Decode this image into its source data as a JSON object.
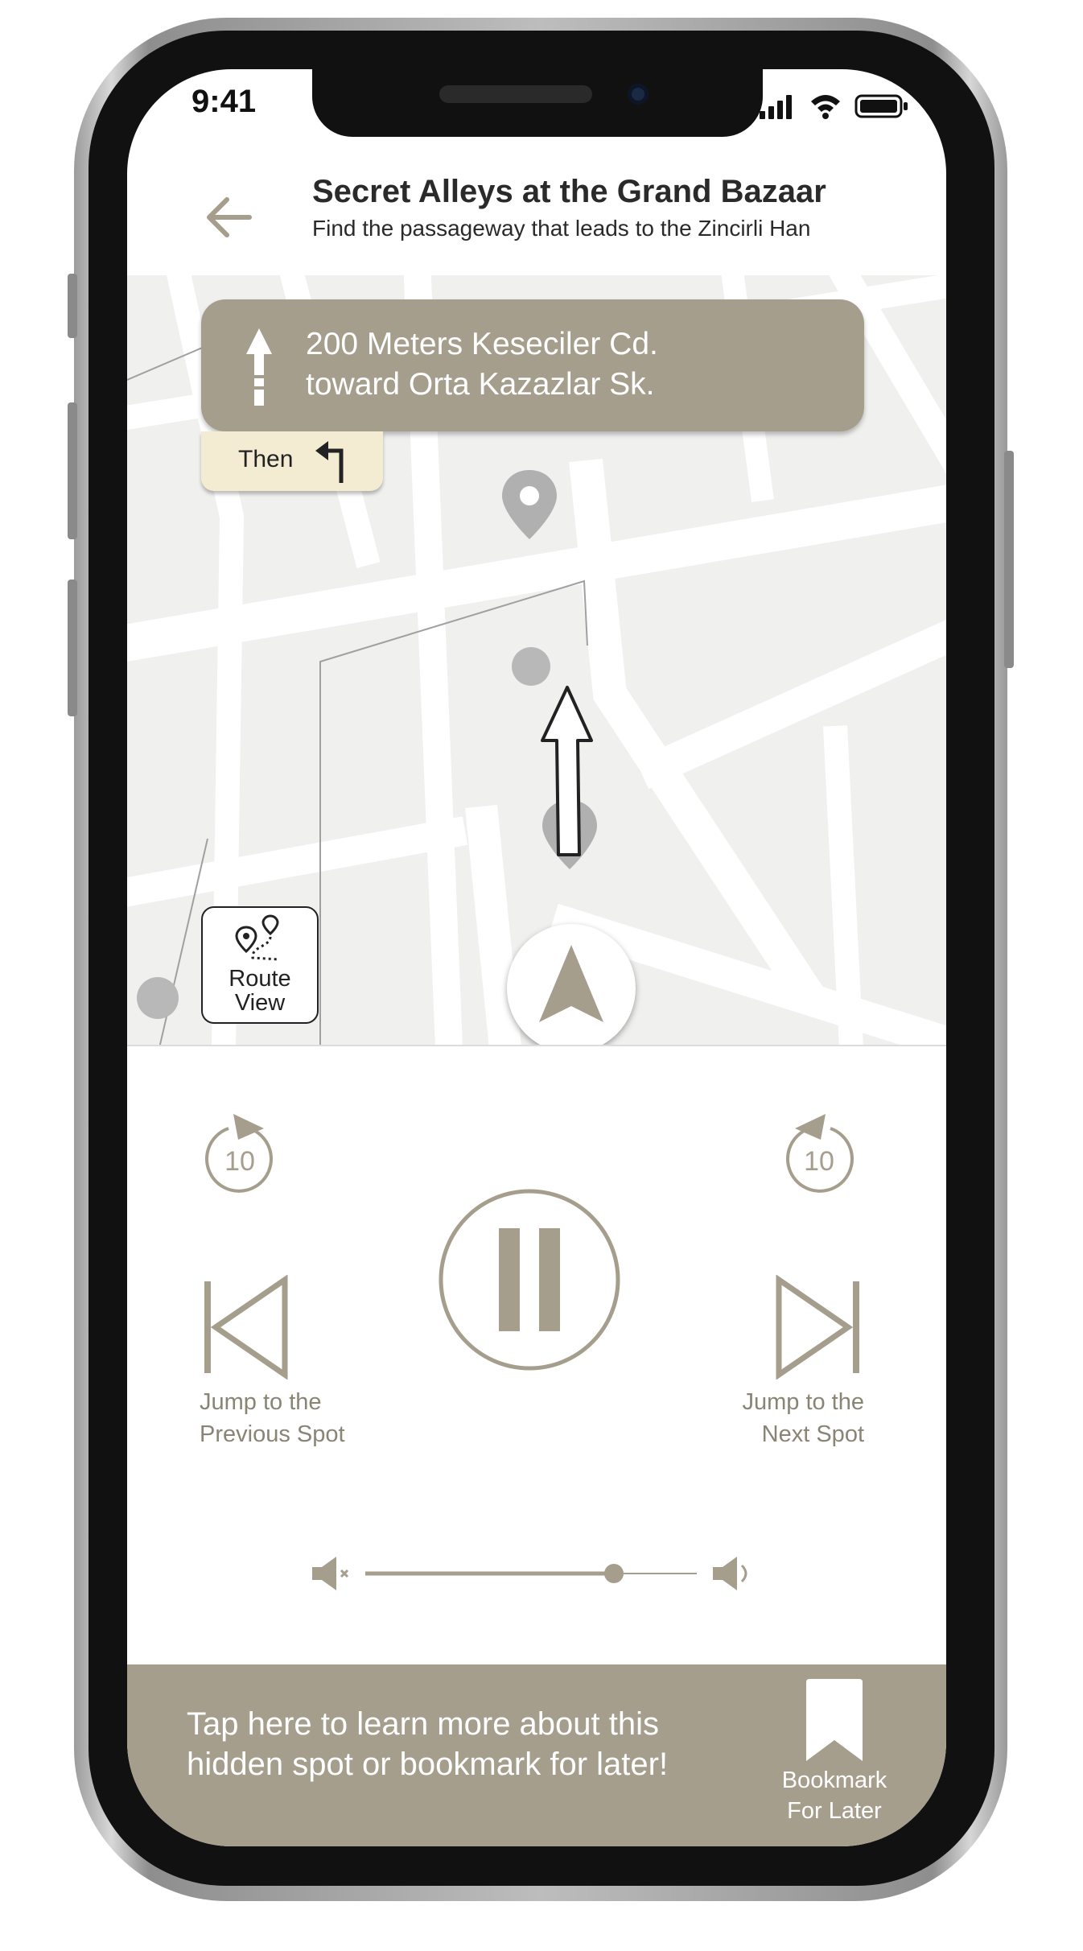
{
  "status_bar": {
    "time": "9:41"
  },
  "header": {
    "title": "Secret Alleys at the Grand Bazaar",
    "subtitle": "Find the passageway that leads to the Zincirli Han"
  },
  "navigation": {
    "line1": "200 Meters Keseciler Cd.",
    "line2": "toward Orta Kazazlar Sk.",
    "then_label": "Then",
    "then_turn": "turn-left-icon"
  },
  "map_controls": {
    "route_view_line1": "Route",
    "route_view_line2": "View"
  },
  "player": {
    "rewind_seconds": "10",
    "forward_seconds": "10",
    "state": "playing",
    "prev_caption_line1": "Jump to the",
    "prev_caption_line2": "Previous Spot",
    "next_caption_line1": "Jump to the",
    "next_caption_line2": "Next Spot",
    "volume_level": 0.75
  },
  "banner": {
    "line1": "Tap here to learn more about this",
    "line2": "hidden spot or bookmark for later!",
    "bookmark_line1": "Bookmark",
    "bookmark_line2": "For Later"
  },
  "colors": {
    "accent": "#a69e8c",
    "accent_dark": "#8a8475",
    "then_tab": "#f4ecd2",
    "map_bg": "#f0f0ef"
  }
}
